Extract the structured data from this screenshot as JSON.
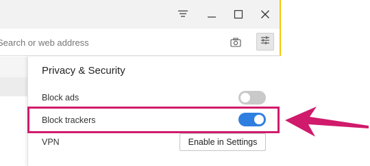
{
  "window_controls": {
    "menu_icon": "hamburger-lines-icon",
    "minimize_icon": "minimize-icon",
    "maximize_icon": "maximize-icon",
    "close_icon": "close-icon"
  },
  "address_bar": {
    "placeholder": "Search or web address",
    "camera_icon": "camera-icon",
    "easy_setup_icon": "sliders-icon"
  },
  "privacy_panel": {
    "title": "Privacy & Security",
    "block_ads": {
      "label": "Block ads",
      "enabled": false
    },
    "block_trackers": {
      "label": "Block trackers",
      "enabled": true
    },
    "vpn": {
      "label": "VPN",
      "button_label": "Enable in Settings"
    }
  },
  "annotation": {
    "color": "#d01a6b"
  },
  "colors": {
    "toggle_on": "#2f7fe0",
    "toggle_off": "#c9c9c9",
    "window_border": "#f3c600"
  }
}
